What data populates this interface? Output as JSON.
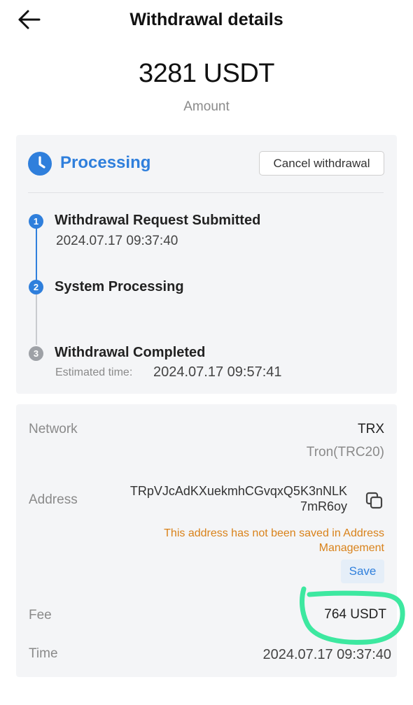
{
  "header": {
    "title": "Withdrawal details",
    "back_icon": "arrow-left-icon"
  },
  "summary": {
    "amount": "3281 USDT",
    "amount_label": "Amount"
  },
  "status": {
    "icon": "clock-icon",
    "text": "Processing",
    "cancel_label": "Cancel withdrawal",
    "accent_color": "#2f7fdc"
  },
  "steps": [
    {
      "number": "1",
      "title": "Withdrawal Request Submitted",
      "time": "2024.07.17 09:37:40",
      "state": "done"
    },
    {
      "number": "2",
      "title": "System Processing",
      "state": "active"
    },
    {
      "number": "3",
      "title": "Withdrawal Completed",
      "estimated_label": "Estimated time:",
      "estimated_time": "2024.07.17 09:57:41",
      "state": "pending"
    }
  ],
  "details": {
    "network_label": "Network",
    "network_value": "TRX",
    "network_sub": "Tron(TRC20)",
    "address_label": "Address",
    "address_line1": "TRpVJcAdKXuekmhCGvqxQ5K3nNLK",
    "address_line2": "7mR6oy",
    "copy_icon": "copy-icon",
    "warning": "This address has not been saved in Address Management",
    "warning_color": "#d9821a",
    "save_label": "Save",
    "fee_label": "Fee",
    "fee_value": "764 USDT",
    "time_label": "Time",
    "time_value": "2024.07.17 09:37:40"
  },
  "annotation": {
    "color": "#3de8a0"
  }
}
